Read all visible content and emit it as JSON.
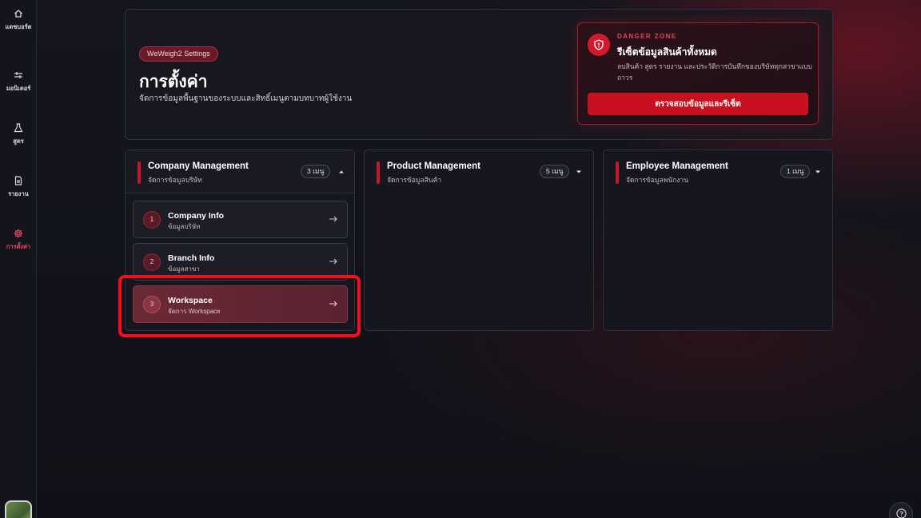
{
  "sidebar": {
    "items": [
      {
        "label": "แดชบอร์ด",
        "icon": "home-icon"
      },
      {
        "label": "มอนิเตอร์",
        "icon": "monitor-icon"
      },
      {
        "label": "สูตร",
        "icon": "flask-icon"
      },
      {
        "label": "รายงาน",
        "icon": "document-icon"
      },
      {
        "label": "การตั้งค่า",
        "icon": "gear-icon",
        "active": true
      }
    ],
    "avatar": "user-avatar"
  },
  "header": {
    "badge": "WeWeigh2 Settings",
    "title": "การตั้งค่า",
    "subtitle": "จัดการข้อมูลพื้นฐานของระบบและสิทธิ์เมนูตามบทบาทผู้ใช้งาน"
  },
  "danger_zone": {
    "tag": "DANGER ZONE",
    "title": "รีเซ็ตข้อมูลสินค้าทั้งหมด",
    "description": "ลบสินค้า สูตร รายงาน และประวัติการบันทึกของบริษัททุกสาขาแบบถาวร",
    "button_label": "ตรวจสอบข้อมูลและรีเซ็ต",
    "icon": "shield-alert-icon"
  },
  "sections": [
    {
      "title": "Company Management",
      "subtitle": "จัดการข้อมูลบริษัท",
      "count": "3 เมนู",
      "expanded": true,
      "items": [
        {
          "num": "1",
          "title": "Company Info",
          "subtitle": "ข้อมูลบริษัท"
        },
        {
          "num": "2",
          "title": "Branch Info",
          "subtitle": "ข้อมูลสาขา"
        },
        {
          "num": "3",
          "title": "Workspace",
          "subtitle": "จัดการ Workspace"
        }
      ]
    },
    {
      "title": "Product Management",
      "subtitle": "จัดการข้อมูลสินค้า",
      "count": "5 เมนู",
      "expanded": false
    },
    {
      "title": "Employee Management",
      "subtitle": "จัดการข้อมูลพนักงาน",
      "count": "1 เมนู",
      "expanded": false
    }
  ],
  "colors": {
    "accent": "#c8182c",
    "danger": "#d31a2c",
    "highlight_ring": "#ff0a1a",
    "background": "#13141b"
  }
}
